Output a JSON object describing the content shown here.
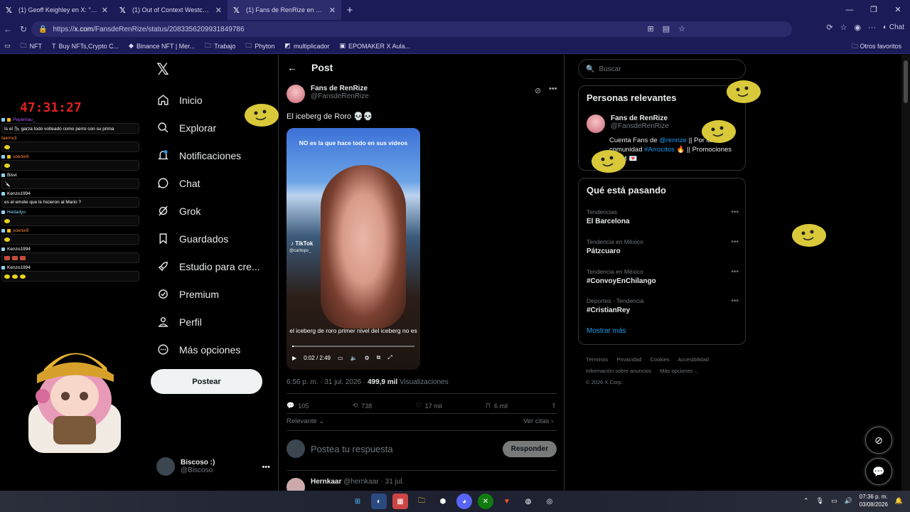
{
  "browser": {
    "tabs": [
      {
        "title": "(1) Geoff Keighley en X: \"Dave Bau"
      },
      {
        "title": "(1) Out of Context Westcol 💀 en X"
      },
      {
        "title": "(1) Fans de RenRize en X: \"El iceb"
      }
    ],
    "url_prefix": "https://",
    "url_host": "x.com",
    "url_path": "/FansdeRenRize/status/2083356209931849786",
    "chat_button": "Chat",
    "bookmarks": [
      "NFT",
      "Buy NFTs,Crypto C...",
      "Binance NFT | Mer...",
      "Trabajo",
      "Phyton",
      "multiplicador",
      "EPOMAKER X Aula..."
    ],
    "other_bookmarks": "Otros favoritos"
  },
  "stream": {
    "timer": "47:31:27",
    "chat": [
      {
        "user": "Pepemau_",
        "text": "Is el 🦍 garza todo volteado como perro con su prima",
        "color": "#b05cff"
      },
      {
        "user": "faemx3",
        "text": "",
        "color": "#ff8a3d"
      },
      {
        "user": "soenix9",
        "text": "",
        "color": "#ff8a3d"
      },
      {
        "user": "Bisvi",
        "text": "",
        "color": "#ffffff"
      },
      {
        "user": "Kenzo1994",
        "text": "es el emote que le hicieron al Mario ?",
        "color": "#ffffff"
      },
      {
        "user": "Hedadyo",
        "text": "",
        "color": "#8bd3ff"
      },
      {
        "user": "soenix9",
        "text": "",
        "color": "#ff8a3d"
      },
      {
        "user": "Kenzo1994",
        "text": "",
        "color": "#ffffff"
      },
      {
        "user": "Kenzo1994",
        "text": "",
        "color": "#ffffff"
      }
    ]
  },
  "nav": {
    "items": [
      {
        "label": "Inicio",
        "icon": "home-icon"
      },
      {
        "label": "Explorar",
        "icon": "search-icon"
      },
      {
        "label": "Notificaciones",
        "icon": "bell-icon"
      },
      {
        "label": "Chat",
        "icon": "chat-icon"
      },
      {
        "label": "Grok",
        "icon": "grok-icon"
      },
      {
        "label": "Guardados",
        "icon": "bookmark-icon"
      },
      {
        "label": "Estudio para cre...",
        "icon": "rocket-icon"
      },
      {
        "label": "Premium",
        "icon": "premium-icon"
      },
      {
        "label": "Perfil",
        "icon": "person-icon"
      },
      {
        "label": "Más opciones",
        "icon": "more-icon"
      }
    ],
    "post_button": "Postear",
    "me_name": "Biscoso :)",
    "me_handle": "@Biscoso"
  },
  "post": {
    "header": "Post",
    "author_name": "Fans de RenRize",
    "author_handle": "@FansdeRenRize",
    "text": "El iceberg de Roro 💀💀",
    "video": {
      "caption_top": "NO es la que hace todo en sus videos",
      "subtitle": "el iceberg de roro primer nivel del iceberg no es",
      "tiktok": "TikTok",
      "tiktok_user": "@caritops_",
      "time": "0:02 / 2:49",
      "progress": 0.012
    },
    "timestamp": "6:56 p. m. · 31 jul. 2026 · ",
    "views_count": "499,9 mil",
    "views_label": " Visualizaciones",
    "replies": "105",
    "reposts": "738",
    "likes": "17 mil",
    "bookmarks": "6 mil",
    "sort": "Relevante",
    "quotes": "Ver citas",
    "reply_placeholder": "Postea tu respuesta",
    "reply_button": "Responder",
    "next_author": "Hernkaar",
    "next_handle": "@hernkaar · 31 jul."
  },
  "right": {
    "search_placeholder": "Buscar",
    "relevant_title": "Personas relevantes",
    "rel_name": "Fans de RenRize",
    "rel_handle": "@FansdeRenRize",
    "bio_pre": "Cuenta Fans de ",
    "bio_link1": "@renrize",
    "bio_mid": " || Por la comunidad ",
    "bio_link2": "#Arrocitos",
    "bio_post": " 🔥 || Promociones al DM 💌",
    "trending_title": "Qué está pasando",
    "trends": [
      {
        "category": "Tendencias",
        "name": "El Barcelona"
      },
      {
        "category": "Tendencia en México",
        "name": "Pátzcuaro"
      },
      {
        "category": "Tendencia en México",
        "name": "#ConvoyEnChilango"
      },
      {
        "category": "Deportes · Tendencia",
        "name": "#CristianRey"
      }
    ],
    "show_more": "Mostrar más",
    "footer": [
      "Términos",
      "Privacidad",
      "Cookies",
      "Accesibilidad",
      "Información sobre anuncios",
      "Más opciones ...",
      "© 2026 X Corp."
    ]
  },
  "taskbar": {
    "time": "07:36 p. m.",
    "date": "03/08/2026"
  }
}
